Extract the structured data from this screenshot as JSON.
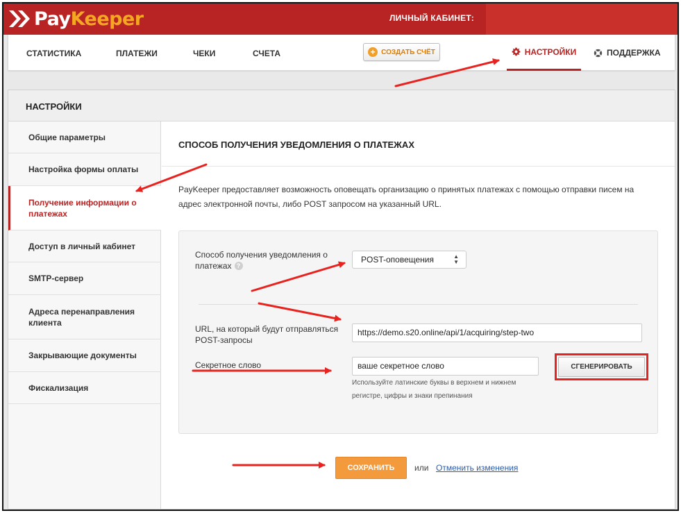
{
  "header": {
    "logo_part1": "Pay",
    "logo_part2": "Keeper",
    "cabinet_label": "ЛИЧНЫЙ КАБИНЕТ:",
    "brand_color": "#b82323",
    "accent_color": "#f5a623"
  },
  "nav": {
    "items": [
      {
        "label": "СТАТИСТИКА"
      },
      {
        "label": "ПЛАТЕЖИ"
      },
      {
        "label": "ЧЕКИ"
      },
      {
        "label": "СЧЕТА"
      }
    ],
    "create_button": "СОЗДАТЬ СЧЁТ",
    "create_icon": "plus-circle-icon",
    "settings": "НАСТРОЙКИ",
    "settings_icon": "gear-icon",
    "support": "ПОДДЕРЖКА",
    "support_icon": "lifebuoy-icon"
  },
  "panel": {
    "title": "НАСТРОЙКИ"
  },
  "sidebar": {
    "items": [
      {
        "label": "Общие параметры"
      },
      {
        "label": "Настройка формы оплаты"
      },
      {
        "label": "Получение информации о платежах",
        "active": true
      },
      {
        "label": "Доступ в личный кабинет"
      },
      {
        "label": "SMTP-сервер"
      },
      {
        "label": "Адреса перенаправления клиента"
      },
      {
        "label": "Закрывающие документы"
      },
      {
        "label": "Фискализация"
      }
    ]
  },
  "main": {
    "section_title": "СПОСОБ ПОЛУЧЕНИЯ УВЕДОМЛЕНИЯ О ПЛАТЕЖАХ",
    "description": "PayKeeper предоставляет возможность оповещать организацию о принятых платежах с помощью отправки писем на адрес электронной почты, либо POST запросом на указанный URL.",
    "method_label": "Способ получения уведомления о платежах",
    "help_icon": "?",
    "method_value": "POST-оповещения",
    "url_label": "URL, на который будут отправляться POST-запросы",
    "url_value": "https://demo.s20.online/api/1/acquiring/step-two",
    "secret_label": "Секретное слово",
    "secret_value": "ваше секретное слово",
    "secret_hint": "Используйте латинские буквы в верхнем и нижнем регистре, цифры и знаки препинания",
    "generate_button": "СГЕНЕРИРОВАТЬ",
    "save_button": "СОХРАНИТЬ",
    "or_text": "или",
    "cancel_link": "Отменить изменения"
  },
  "annotation_color": "#e8231f"
}
